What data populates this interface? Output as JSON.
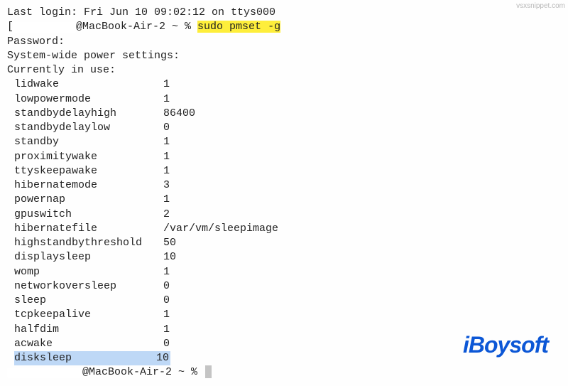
{
  "source_tag": "vsxsnippet.com",
  "login_line": "Last login: Fri Jun 10 09:02:12 on ttys000",
  "prompt_host": "@MacBook-Air-2 ~ % ",
  "command": "sudo pmset -g",
  "password_label": "Password:",
  "header_line": "System-wide power settings:",
  "subheader_line": "Currently in use:",
  "settings": [
    {
      "key": "lidwake",
      "value": "1"
    },
    {
      "key": "lowpowermode",
      "value": "1"
    },
    {
      "key": "standbydelayhigh",
      "value": "86400"
    },
    {
      "key": "standbydelaylow",
      "value": "0"
    },
    {
      "key": "standby",
      "value": "1"
    },
    {
      "key": "proximitywake",
      "value": "1"
    },
    {
      "key": "ttyskeepawake",
      "value": "1"
    },
    {
      "key": "hibernatemode",
      "value": "3"
    },
    {
      "key": "powernap",
      "value": "1"
    },
    {
      "key": "gpuswitch",
      "value": "2"
    },
    {
      "key": "hibernatefile",
      "value": "/var/vm/sleepimage"
    },
    {
      "key": "highstandbythreshold",
      "value": "50"
    },
    {
      "key": "displaysleep",
      "value": "10"
    },
    {
      "key": "womp",
      "value": "1"
    },
    {
      "key": "networkoversleep",
      "value": "0"
    },
    {
      "key": "sleep",
      "value": "0"
    },
    {
      "key": "tcpkeepalive",
      "value": "1"
    },
    {
      "key": "halfdim",
      "value": "1"
    },
    {
      "key": "acwake",
      "value": "0"
    },
    {
      "key": "disksleep",
      "value": "10"
    }
  ],
  "watermark": "iBoysoft"
}
